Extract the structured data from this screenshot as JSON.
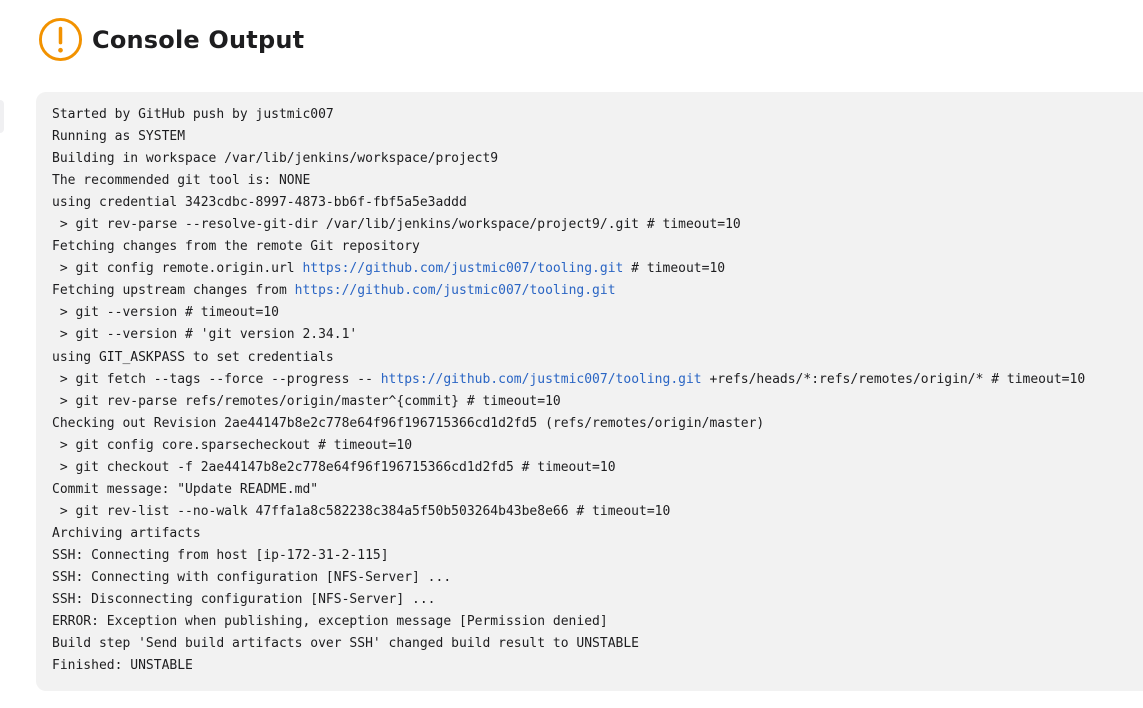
{
  "header": {
    "title": "Console Output",
    "icon": "exclamation-circle-icon",
    "status_color": "#f29200"
  },
  "colors": {
    "console_bg": "#f2f2f2",
    "link": "#2a65c4",
    "text": "#1d1d1f"
  },
  "console": {
    "lines": [
      [
        "Started by GitHub push by justmic007"
      ],
      [
        "Running as SYSTEM"
      ],
      [
        "Building in workspace /var/lib/jenkins/workspace/project9"
      ],
      [
        "The recommended git tool is: NONE"
      ],
      [
        "using credential 3423cdbc-8997-4873-bb6f-fbf5a5e3addd"
      ],
      [
        " > git rev-parse --resolve-git-dir /var/lib/jenkins/workspace/project9/.git # timeout=10"
      ],
      [
        "Fetching changes from the remote Git repository"
      ],
      [
        " > git config remote.origin.url ",
        "https://github.com/justmic007/tooling.git",
        " # timeout=10"
      ],
      [
        "Fetching upstream changes from ",
        "https://github.com/justmic007/tooling.git",
        ""
      ],
      [
        " > git --version # timeout=10"
      ],
      [
        " > git --version # 'git version 2.34.1'"
      ],
      [
        "using GIT_ASKPASS to set credentials"
      ],
      [
        " > git fetch --tags --force --progress -- ",
        "https://github.com/justmic007/tooling.git",
        " +refs/heads/*:refs/remotes/origin/* # timeout=10"
      ],
      [
        " > git rev-parse refs/remotes/origin/master^{commit} # timeout=10"
      ],
      [
        "Checking out Revision 2ae44147b8e2c778e64f96f196715366cd1d2fd5 (refs/remotes/origin/master)"
      ],
      [
        " > git config core.sparsecheckout # timeout=10"
      ],
      [
        " > git checkout -f 2ae44147b8e2c778e64f96f196715366cd1d2fd5 # timeout=10"
      ],
      [
        "Commit message: \"Update README.md\""
      ],
      [
        " > git rev-list --no-walk 47ffa1a8c582238c384a5f50b503264b43be8e66 # timeout=10"
      ],
      [
        "Archiving artifacts"
      ],
      [
        "SSH: Connecting from host [ip-172-31-2-115]"
      ],
      [
        "SSH: Connecting with configuration [NFS-Server] ..."
      ],
      [
        "SSH: Disconnecting configuration [NFS-Server] ..."
      ],
      [
        "ERROR: Exception when publishing, exception message [Permission denied]"
      ],
      [
        "Build step 'Send build artifacts over SSH' changed build result to UNSTABLE"
      ],
      [
        "Finished: UNSTABLE"
      ]
    ]
  }
}
